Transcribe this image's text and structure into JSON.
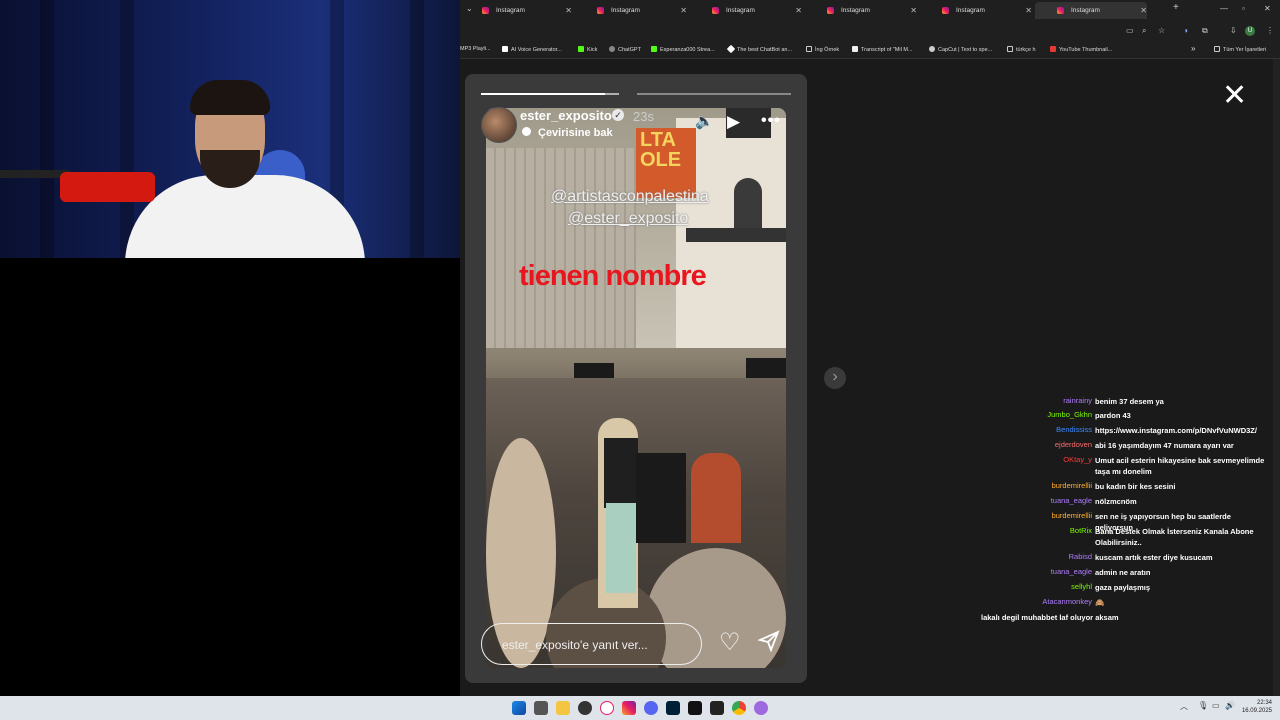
{
  "browser": {
    "tabs": [
      {
        "title": "Instagram"
      },
      {
        "title": "Instagram"
      },
      {
        "title": "Instagram"
      },
      {
        "title": "Instagram"
      },
      {
        "title": "Instagram"
      },
      {
        "title": "Instagram"
      }
    ],
    "new_tab": "+",
    "bookmarks": [
      "MP3 Playli...",
      "AI Voice Generator...",
      "Kick",
      "ChatGPT",
      "Esperanza000 Strea...",
      "The best ChatBot an...",
      "İng Örnek",
      "Transcript of \"Mil M...",
      "CapCut | Text to spe...",
      "türkçe h",
      "YouTube Thumbnail..."
    ],
    "bookmarks_more": "»",
    "all_bookmarks": "Tüm Yer İşaretleri"
  },
  "story": {
    "username": "ester_exposito",
    "time": "23s",
    "translation": "Çevirisine bak",
    "overlay_mention_1": "@artistasconpalestina",
    "overlay_mention_2": "@ester_exposito",
    "overlay_text": "tienen nombre",
    "sign_text": "LTA\nOLE",
    "reply_placeholder": "ester_exposito'e yanıt ver...",
    "progress": [
      0.8,
      0
    ]
  },
  "close_glyph": "✕",
  "next_glyph": "›",
  "chat": [
    {
      "user": "rainrainy",
      "color": "#b07cff",
      "msg": "benim 37 desem ya"
    },
    {
      "user": "Jumbo_Gkhn",
      "color": "#7cfc00",
      "msg": "pardon 43"
    },
    {
      "user": "Bendississ",
      "color": "#3b8bff",
      "msg": "https://www.instagram.com/p/DNvfVuNWD3Z/"
    },
    {
      "user": "ejderdoven",
      "color": "#ff6b6b",
      "msg": "abi 16 yaşımdayım 47 numara ayarı var"
    },
    {
      "user": "OKtay_y",
      "color": "#ff3b3b",
      "msg": "Umut acil esterin hikayesine bak sevmeyelimde taşa mı donelim"
    },
    {
      "user": "burdemirellii",
      "color": "#ffb02e",
      "msg": "bu kadın bir kes sesini"
    },
    {
      "user": "tuana_eagle",
      "color": "#b07cff",
      "msg": "nölzmcnöm"
    },
    {
      "user": "burdemirellii",
      "color": "#ffb02e",
      "msg": "sen ne iş yapıyorsun hep bu saatlerde geliyorsun"
    },
    {
      "user": "BotRix",
      "color": "#7cfc00",
      "msg": "Bana Destek Olmak İsterseniz Kanala Abone Olabilirsiniz.."
    },
    {
      "user": "Rabisd",
      "color": "#b07cff",
      "msg": "kuscam artık ester diye kusucam"
    },
    {
      "user": "tuana_eagle",
      "color": "#b07cff",
      "msg": "admin ne aratın"
    },
    {
      "user": "sellyhl",
      "color": "#7cfc00",
      "msg": "gaza paylaşmış"
    },
    {
      "user": "Atacanmonkey",
      "color": "#b07cff",
      "msg": "🙈"
    },
    {
      "user": "",
      "color": "#fff",
      "msg": "lakalı degil muhabbet laf oluyor aksam"
    }
  ],
  "taskbar": {
    "time": "22:34",
    "date": "16.09.2025"
  }
}
